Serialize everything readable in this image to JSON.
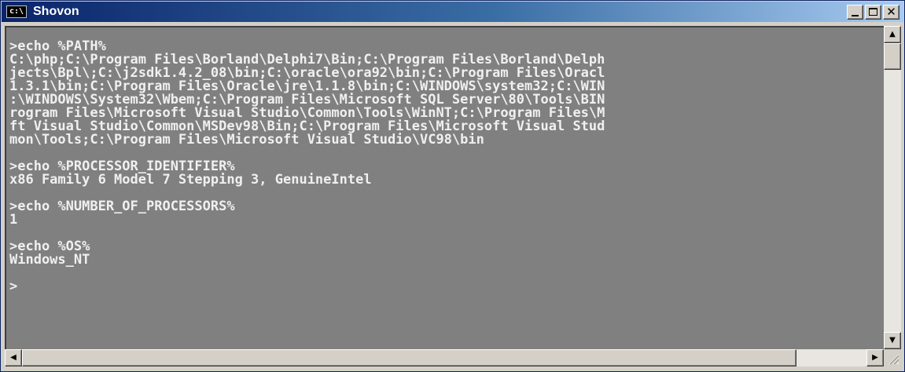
{
  "window": {
    "title": "Shovon",
    "app_icon_label": "c:\\",
    "controls": {
      "minimize_icon": "minimize-icon",
      "maximize_icon": "maximize-icon",
      "close_icon": "close-icon"
    }
  },
  "console": {
    "lines": [
      ">echo %PATH%",
      "C:\\php;C:\\Program Files\\Borland\\Delphi7\\Bin;C:\\Program Files\\Borland\\Delph",
      "jects\\Bpl\\;C:\\j2sdk1.4.2_08\\bin;C:\\oracle\\ora92\\bin;C:\\Program Files\\Oracl",
      "1.3.1\\bin;C:\\Program Files\\Oracle\\jre\\1.1.8\\bin;C:\\WINDOWS\\system32;C:\\WIN",
      ":\\WINDOWS\\System32\\Wbem;C:\\Program Files\\Microsoft SQL Server\\80\\Tools\\BIN",
      "rogram Files\\Microsoft Visual Studio\\Common\\Tools\\WinNT;C:\\Program Files\\M",
      "ft Visual Studio\\Common\\MSDev98\\Bin;C:\\Program Files\\Microsoft Visual Stud",
      "mon\\Tools;C:\\Program Files\\Microsoft Visual Studio\\VC98\\bin",
      "",
      ">echo %PROCESSOR_IDENTIFIER%",
      "x86 Family 6 Model 7 Stepping 3, GenuineIntel",
      "",
      ">echo %NUMBER_OF_PROCESSORS%",
      "1",
      "",
      ">echo %OS%",
      "Windows_NT",
      "",
      ">"
    ]
  },
  "scrollbars": {
    "vertical": {
      "up_icon": "scroll-up-icon",
      "down_icon": "scroll-down-icon",
      "position": 0.0
    },
    "horizontal": {
      "left_icon": "scroll-left-icon",
      "right_icon": "scroll-right-icon",
      "position": 0.0
    }
  },
  "colors": {
    "titlebar_start": "#0a246a",
    "titlebar_end": "#a6caf0",
    "console_background": "#808080",
    "console_text": "#f0f0f0",
    "chrome": "#d4d0c8"
  }
}
